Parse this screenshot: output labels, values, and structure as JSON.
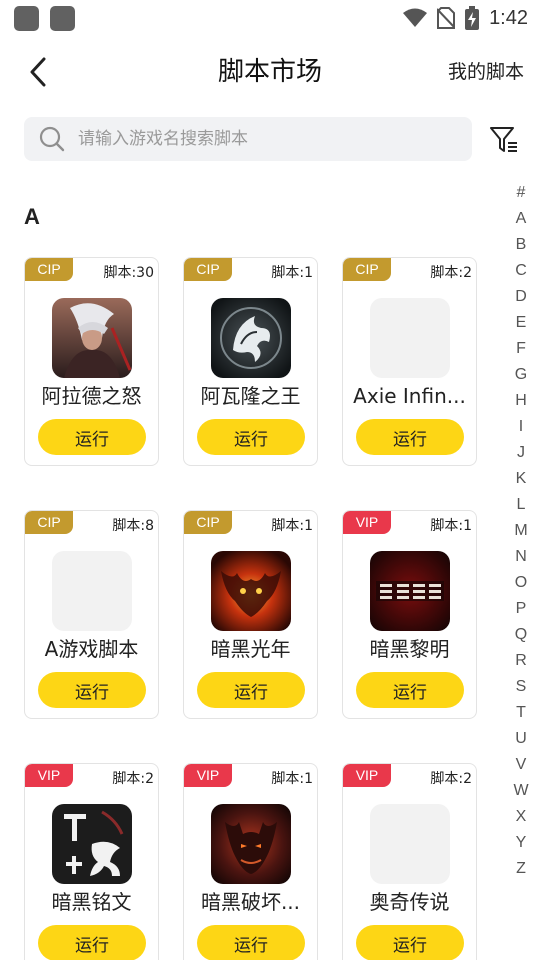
{
  "status_bar": {
    "time": "1:42"
  },
  "header": {
    "title": "脚本市场",
    "my_scripts": "我的脚本"
  },
  "search": {
    "placeholder": "请输入游戏名搜索脚本",
    "value": ""
  },
  "section": {
    "letter": "A"
  },
  "run_label": "运行",
  "games": [
    {
      "tag": "CIP",
      "count": "脚本:30",
      "name": "阿拉德之怒",
      "icon": "hooded-warrior-icon"
    },
    {
      "tag": "CIP",
      "count": "脚本:1",
      "name": "阿瓦隆之王",
      "icon": "dragon-emblem-icon"
    },
    {
      "tag": "CIP",
      "count": "脚本:2",
      "name": "Axie Infin...",
      "icon": "placeholder-icon"
    },
    {
      "tag": "CIP",
      "count": "脚本:8",
      "name": "A游戏脚本",
      "icon": "placeholder-icon"
    },
    {
      "tag": "CIP",
      "count": "脚本:1",
      "name": "暗黑光年",
      "icon": "fire-demon-icon"
    },
    {
      "tag": "VIP",
      "count": "脚本:1",
      "name": "暗黑黎明",
      "icon": "dark-dawn-logo-icon"
    },
    {
      "tag": "VIP",
      "count": "脚本:2",
      "name": "暗黑铭文",
      "icon": "calligraphy-logo-icon"
    },
    {
      "tag": "VIP",
      "count": "脚本:1",
      "name": "暗黑破坏...",
      "icon": "demon-face-icon"
    },
    {
      "tag": "VIP",
      "count": "脚本:2",
      "name": "奥奇传说",
      "icon": "placeholder-icon"
    }
  ],
  "alphabet_index": [
    "#",
    "A",
    "B",
    "C",
    "D",
    "E",
    "F",
    "G",
    "H",
    "I",
    "J",
    "K",
    "L",
    "M",
    "N",
    "O",
    "P",
    "Q",
    "R",
    "S",
    "T",
    "U",
    "V",
    "W",
    "X",
    "Y",
    "Z"
  ],
  "colors": {
    "cip_tag": "#c39a2e",
    "vip_tag": "#e9384b",
    "run_button": "#fdd615",
    "search_bg": "#f1f2f4"
  }
}
